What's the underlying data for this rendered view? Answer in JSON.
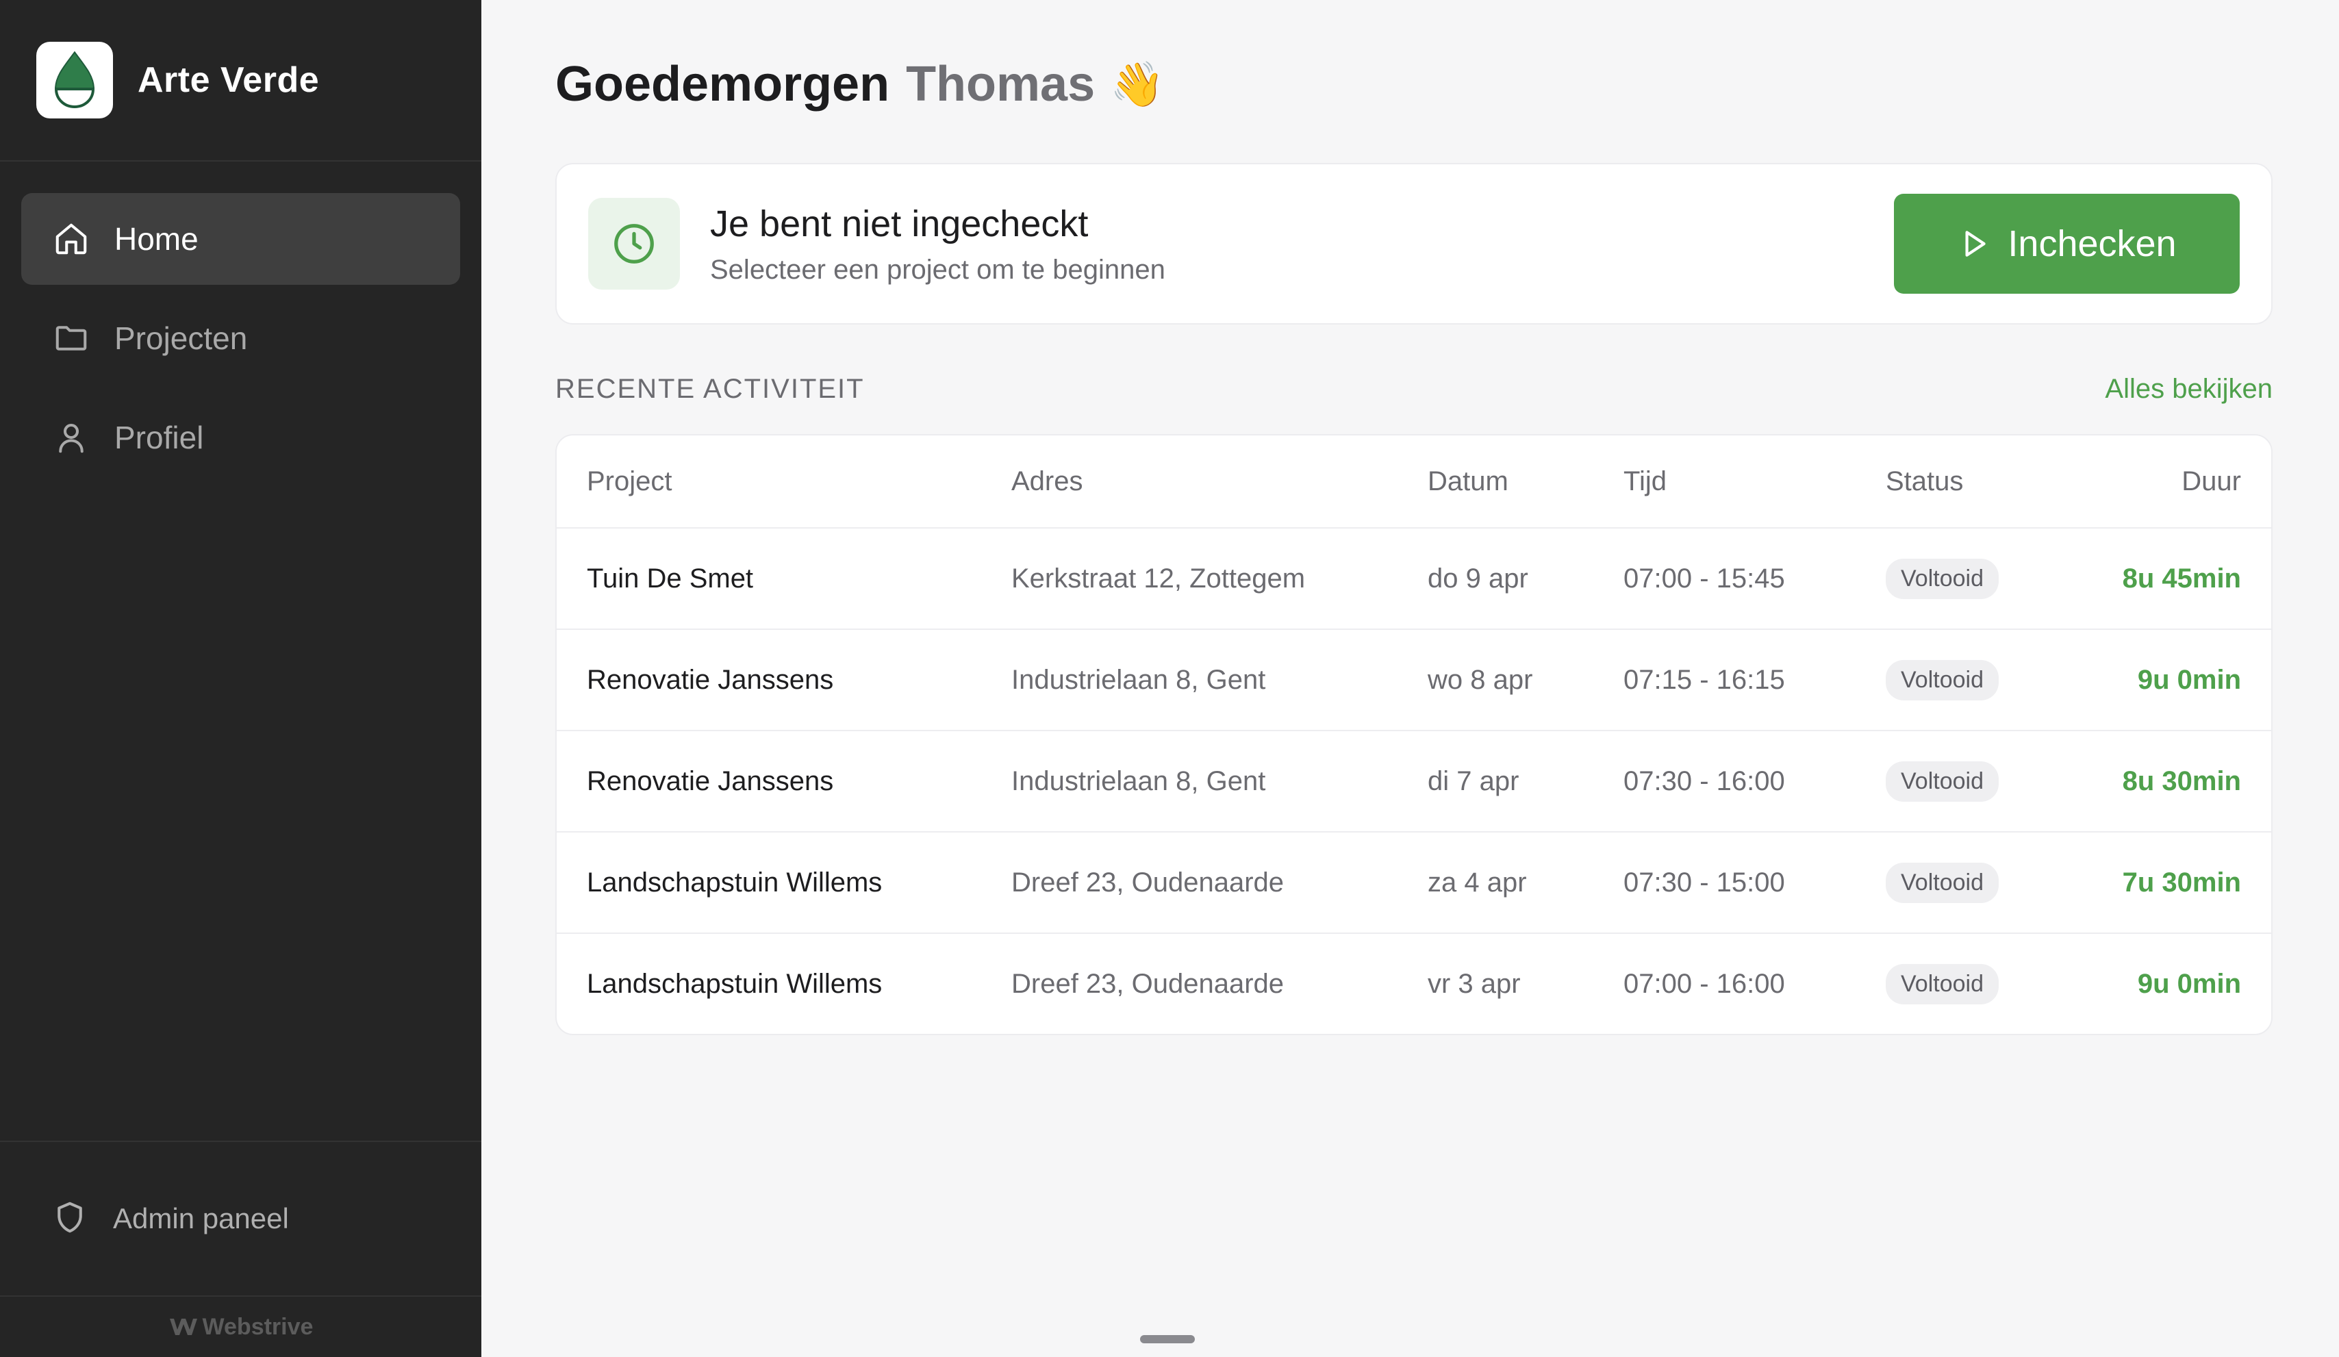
{
  "brand": {
    "name": "Arte Verde"
  },
  "sidebar": {
    "items": [
      {
        "label": "Home",
        "icon": "home-icon",
        "active": true
      },
      {
        "label": "Projecten",
        "icon": "folder-icon",
        "active": false
      },
      {
        "label": "Profiel",
        "icon": "user-icon",
        "active": false
      }
    ],
    "admin_label": "Admin paneel",
    "footer": "Webstrive"
  },
  "greeting": {
    "text": "Goedemorgen",
    "name": "Thomas",
    "emoji": "👋"
  },
  "checkin": {
    "title": "Je bent niet ingecheckt",
    "subtitle": "Selecteer een project om te beginnen",
    "button_label": "Inchecken"
  },
  "activity": {
    "title": "RECENTE ACTIVITEIT",
    "view_all": "Alles bekijken",
    "columns": [
      "Project",
      "Adres",
      "Datum",
      "Tijd",
      "Status",
      "Duur"
    ],
    "rows": [
      {
        "project": "Tuin De Smet",
        "adres": "Kerkstraat 12, Zottegem",
        "datum": "do 9 apr",
        "tijd": "07:00 - 15:45",
        "status": "Voltooid",
        "duur": "8u 45min"
      },
      {
        "project": "Renovatie Janssens",
        "adres": "Industrielaan 8, Gent",
        "datum": "wo 8 apr",
        "tijd": "07:15 - 16:15",
        "status": "Voltooid",
        "duur": "9u 0min"
      },
      {
        "project": "Renovatie Janssens",
        "adres": "Industrielaan 8, Gent",
        "datum": "di 7 apr",
        "tijd": "07:30 - 16:00",
        "status": "Voltooid",
        "duur": "8u 30min"
      },
      {
        "project": "Landschapstuin Willems",
        "adres": "Dreef 23, Oudenaarde",
        "datum": "za 4 apr",
        "tijd": "07:30 - 15:00",
        "status": "Voltooid",
        "duur": "7u 30min"
      },
      {
        "project": "Landschapstuin Willems",
        "adres": "Dreef 23, Oudenaarde",
        "datum": "vr 3 apr",
        "tijd": "07:00 - 16:00",
        "status": "Voltooid",
        "duur": "9u 0min"
      }
    ]
  },
  "colors": {
    "accent": "#4ea04b",
    "sidebar_bg": "#252525",
    "page_bg": "#f6f6f7"
  }
}
